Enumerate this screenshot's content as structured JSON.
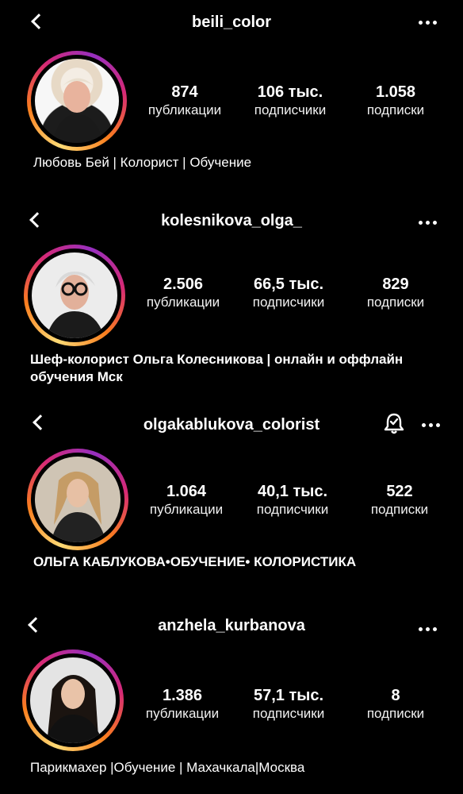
{
  "profiles": [
    {
      "username": "beili_color",
      "stats": [
        {
          "value": "874",
          "label": "публикации"
        },
        {
          "value": "106 тыс.",
          "label": "подписчики"
        },
        {
          "value": "1.058",
          "label": "подписки"
        }
      ],
      "bio": "Любовь Бей | Колорист | Обучение"
    },
    {
      "username": "kolesnikova_olga_",
      "stats": [
        {
          "value": "2.506",
          "label": "публикации"
        },
        {
          "value": "66,5 тыс.",
          "label": "подписчики"
        },
        {
          "value": "829",
          "label": "подписки"
        }
      ],
      "bio_line1": "Шеф-колорист Ольга Колесникова | онлайн и оффлайн",
      "bio_line2": "обучения Мск"
    },
    {
      "username": "olgakablukova_colorist",
      "stats": [
        {
          "value": "1.064",
          "label": "публикации"
        },
        {
          "value": "40,1 тыс.",
          "label": "подписчики"
        },
        {
          "value": "522",
          "label": "подписки"
        }
      ],
      "bio": "ОЛЬГА КАБЛУКОВА•ОБУЧЕНИЕ• КОЛОРИСТИКА"
    },
    {
      "username": "anzhela_kurbanova",
      "stats": [
        {
          "value": "1.386",
          "label": "публикации"
        },
        {
          "value": "57,1 тыс.",
          "label": "подписчики"
        },
        {
          "value": "8",
          "label": "подписки"
        }
      ],
      "bio": "Парикмахер |Обучение | Махачкала|Москва"
    }
  ],
  "icons": {
    "back": "chevron-left-icon",
    "more": "more-dots-icon",
    "bell": "notification-bell-icon"
  }
}
